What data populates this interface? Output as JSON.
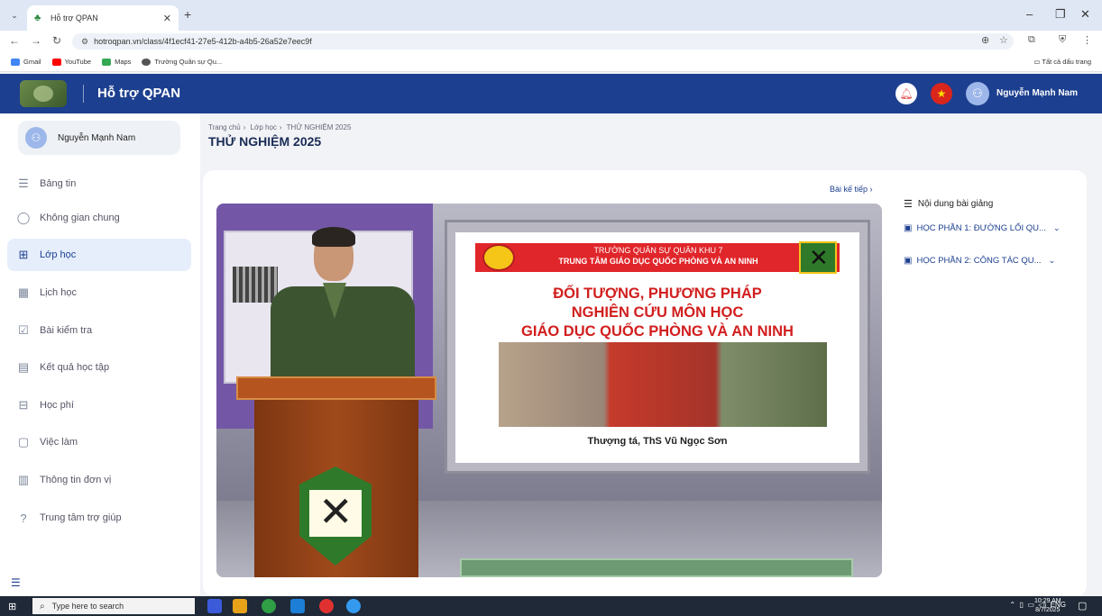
{
  "browser": {
    "tab_title": "Hỗ trợ QPAN",
    "url": "hotroqpan.vn/class/4f1ecf41-27e5-412b-a4b5-26a52e7eec9f",
    "bookmarks": [
      "Gmail",
      "YouTube",
      "Maps",
      "Trường Quân sự Qu..."
    ],
    "all_bookmarks": "Tất cả dấu trang"
  },
  "app": {
    "brand": "Hỗ trợ QPAN",
    "user_name": "Nguyễn Mạnh Nam"
  },
  "sidebar": {
    "user_name": "Nguyễn Mạnh Nam",
    "items": [
      {
        "label": "Bảng tin",
        "icon": "newsfeed-icon",
        "active": false
      },
      {
        "label": "Không gian chung",
        "icon": "chat-bubble-icon",
        "active": false
      },
      {
        "label": "Lớp học",
        "icon": "grid-icon",
        "active": true
      },
      {
        "label": "Lịch học",
        "icon": "calendar-icon",
        "active": false
      },
      {
        "label": "Bài kiểm tra",
        "icon": "test-icon",
        "active": false
      },
      {
        "label": "Kết quả học tập",
        "icon": "report-icon",
        "active": false
      },
      {
        "label": "Học phí",
        "icon": "fee-icon",
        "active": false
      },
      {
        "label": "Việc làm",
        "icon": "briefcase-icon",
        "active": false
      },
      {
        "label": "Thông tin đơn vị",
        "icon": "building-icon",
        "active": false
      },
      {
        "label": "Trung tâm trợ giúp",
        "icon": "help-icon",
        "active": false
      }
    ]
  },
  "breadcrumb": {
    "home": "Trang chủ",
    "classes": "Lớp học",
    "current": "THỬ NGHIỆM 2025"
  },
  "page_title": "THỬ NGHIỆM 2025",
  "next_lesson": "Bài kế tiếp",
  "video_slide": {
    "org_line1": "TRƯỜNG QUÂN SỰ QUÂN KHU 7",
    "org_line2": "TRUNG TÂM GIÁO DỤC QUỐC PHÒNG VÀ AN NINH",
    "title_line1": "ĐỐI TƯỢNG, PHƯƠNG PHÁP",
    "title_line2": "NGHIÊN CỨU MÔN HỌC",
    "title_line3": "GIÁO DỤC QUỐC PHÒNG VÀ AN NINH",
    "speaker": "Thượng tá, ThS Vũ Ngọc Sơn"
  },
  "content_panel": {
    "heading": "Nội dung bài giảng",
    "sections": [
      "HỌC PHẦN 1: ĐƯỜNG LỐI QU...",
      "HỌC PHẦN 2: CÔNG TÁC QU..."
    ]
  },
  "taskbar": {
    "search_placeholder": "Type here to search",
    "language": "ENG",
    "time": "10:29 AM",
    "date": "8/7/2025"
  },
  "colors": {
    "brand_blue": "#1c3f8f",
    "active_bg": "#e6eefc",
    "slide_red": "#d21e1e"
  }
}
